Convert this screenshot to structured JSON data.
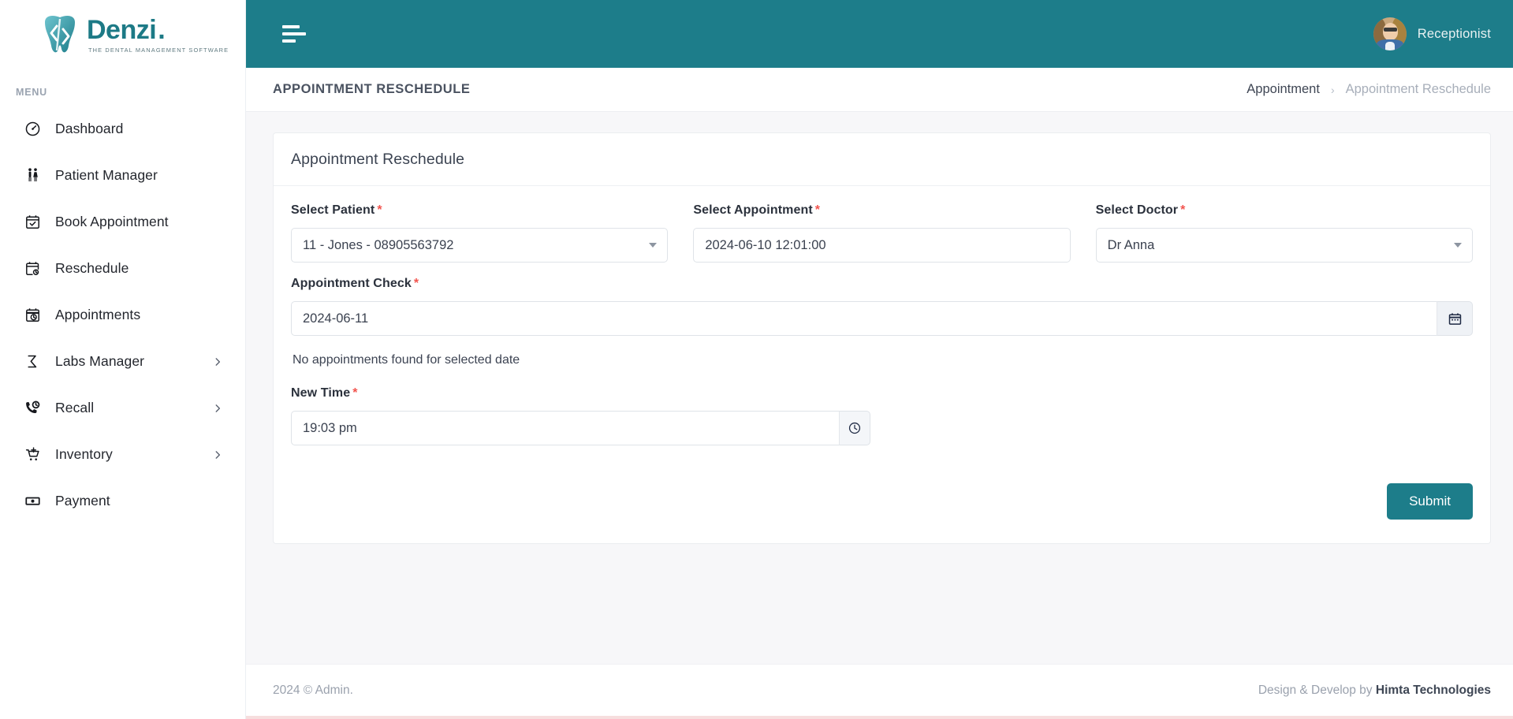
{
  "brand": {
    "name": "Denzi",
    "dot": ".",
    "tagline": "THE DENTAL MANAGEMENT SOFTWARE",
    "logo_icon": "tooth-code-logo-icon",
    "accent_color": "#1d7d8a"
  },
  "sidebar": {
    "section_label": "MENU",
    "items": [
      {
        "label": "Dashboard",
        "icon": "speedometer-icon",
        "has_chevron": false
      },
      {
        "label": "Patient Manager",
        "icon": "two-people-icon",
        "has_chevron": false
      },
      {
        "label": "Book Appointment",
        "icon": "calendar-check-icon",
        "has_chevron": false
      },
      {
        "label": "Reschedule",
        "icon": "calendar-refresh-icon",
        "has_chevron": false
      },
      {
        "label": "Appointments",
        "icon": "calendar-clock-icon",
        "has_chevron": false
      },
      {
        "label": "Labs Manager",
        "icon": "flask-sigma-icon",
        "has_chevron": true
      },
      {
        "label": "Recall",
        "icon": "phone-clock-icon",
        "has_chevron": true
      },
      {
        "label": "Inventory",
        "icon": "cart-plus-icon",
        "has_chevron": true
      },
      {
        "label": "Payment",
        "icon": "banknote-icon",
        "has_chevron": false
      }
    ]
  },
  "topbar": {
    "menu_toggle_icon": "hamburger-icon",
    "user_name": "Receptionist",
    "avatar_icon": "user-avatar-photo"
  },
  "titlebar": {
    "page_title": "APPOINTMENT RESCHEDULE",
    "breadcrumb": {
      "parent": "Appointment",
      "separator": "›",
      "current": "Appointment Reschedule"
    }
  },
  "card": {
    "title": "Appointment Reschedule",
    "fields": {
      "select_patient": {
        "label": "Select Patient",
        "required_mark": "*",
        "value": "11 - Jones - 08905563792",
        "control": "select",
        "caret_icon": "chevron-down-icon"
      },
      "select_appointment": {
        "label": "Select Appointment",
        "required_mark": "*",
        "value": "2024-06-10 12:01:00",
        "control": "text"
      },
      "select_doctor": {
        "label": "Select Doctor",
        "required_mark": "*",
        "value": "Dr Anna",
        "control": "select",
        "caret_icon": "chevron-down-icon"
      },
      "appointment_check": {
        "label": "Appointment Check",
        "required_mark": "*",
        "value": "2024-06-11",
        "addon_icon": "calendar-icon"
      },
      "appointment_check_hint": "No appointments found for selected date",
      "new_time": {
        "label": "New Time",
        "required_mark": "*",
        "value": "19:03 pm",
        "addon_icon": "clock-icon"
      }
    },
    "submit_label": "Submit"
  },
  "footer": {
    "left": "2024 © Admin.",
    "right_prefix": "Design & Develop by ",
    "right_brand": "Himta Technologies"
  }
}
